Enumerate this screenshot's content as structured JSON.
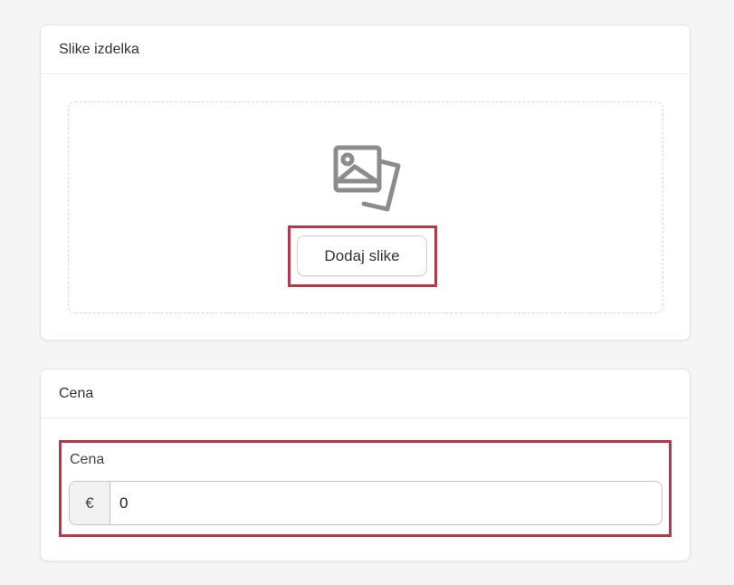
{
  "images_card": {
    "title": "Slike izdelka",
    "upload_button_label": "Dodaj slike",
    "icon": "image-placeholder-icon"
  },
  "price_card": {
    "title": "Cena",
    "field_label": "Cena",
    "currency_symbol": "€",
    "value": "0"
  },
  "colors": {
    "highlight": "#b5394a",
    "background": "#f5f5f5"
  }
}
